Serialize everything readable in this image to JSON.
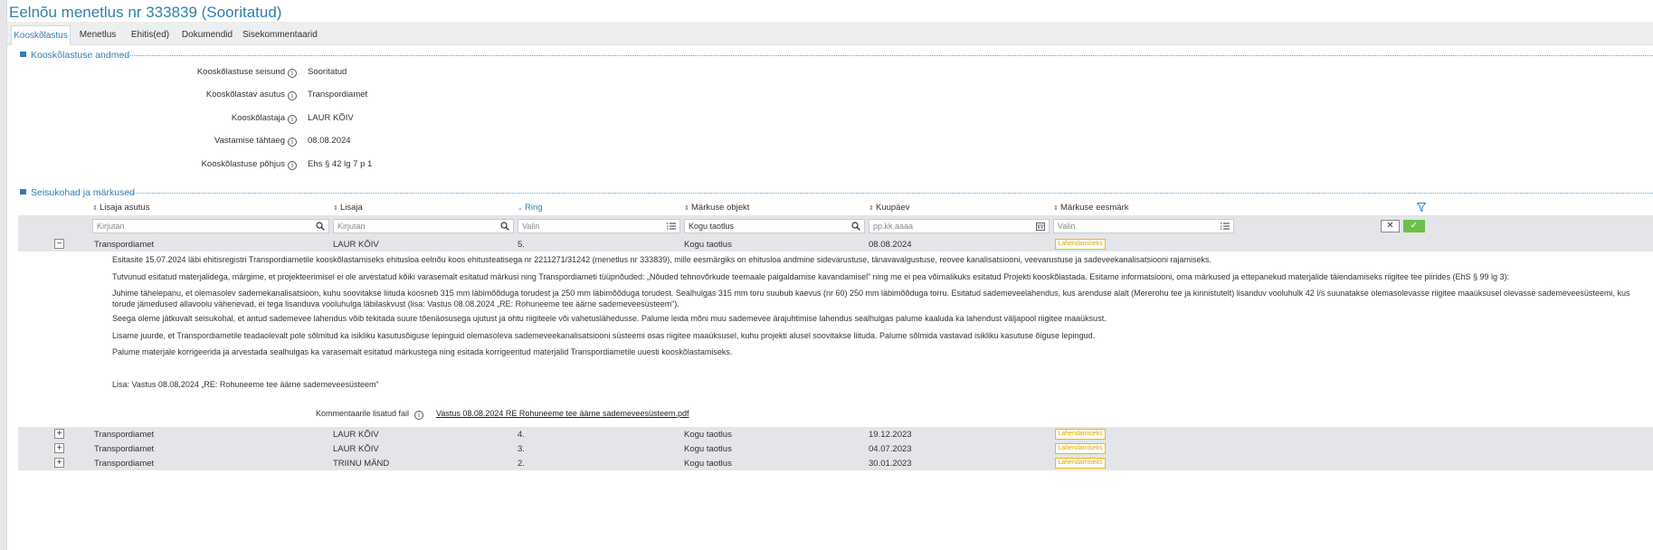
{
  "title": "Eelnõu menetlus nr 333839 (Sooritatud)",
  "tabs": [
    {
      "label": "Kooskõlastus"
    },
    {
      "label": "Menetlus"
    },
    {
      "label": "Ehitis(ed)"
    },
    {
      "label": "Dokumendid"
    },
    {
      "label": "Sisekommentaarid"
    }
  ],
  "section1": {
    "title": "Kooskõlastuse andmed",
    "fields": [
      {
        "label": "Kooskõlastuse seisund",
        "value": "Sooritatud"
      },
      {
        "label": "Kooskõlastav asutus",
        "value": "Transpordiamet"
      },
      {
        "label": "Kooskõlastaja",
        "value": "LAUR KÕIV"
      },
      {
        "label": "Vastamise tähtaeg",
        "value": "08.08.2024"
      },
      {
        "label": "Kooskõlastuse põhjus",
        "value": "Ehs § 42 lg 7 p 1"
      }
    ]
  },
  "section2": {
    "title": "Seisukohad ja märkused",
    "columns": [
      {
        "label": "Lisaja asutus"
      },
      {
        "label": "Lisaja"
      },
      {
        "label": "Ring"
      },
      {
        "label": "Märkuse objekt"
      },
      {
        "label": "Kuupäev"
      },
      {
        "label": "Märkuse eesmärk"
      }
    ],
    "filters": [
      {
        "placeholder": "Kirjutan"
      },
      {
        "placeholder": "Kirjutan"
      },
      {
        "placeholder": "Valin"
      },
      {
        "value": "Kogu taotlus"
      },
      {
        "placeholder": "pp.kk.aaaa"
      },
      {
        "placeholder": "Valin"
      }
    ],
    "rows": [
      {
        "toggle": "−",
        "asutus": "Transpordiamet",
        "lisaja": "LAUR KÕIV",
        "ring": "5.",
        "objekt": "Kogu taotlus",
        "kuupaev": "08.08.2024",
        "eesmark": "Lahendamiseks"
      },
      {
        "toggle": "+",
        "asutus": "Transpordiamet",
        "lisaja": "LAUR KÕIV",
        "ring": "4.",
        "objekt": "Kogu taotlus",
        "kuupaev": "19.12.2023",
        "eesmark": "Lahendamiseks"
      },
      {
        "toggle": "+",
        "asutus": "Transpordiamet",
        "lisaja": "LAUR KÕIV",
        "ring": "3.",
        "objekt": "Kogu taotlus",
        "kuupaev": "04.07.2023",
        "eesmark": "Lahendamiseks"
      },
      {
        "toggle": "+",
        "asutus": "Transpordiamet",
        "lisaja": "TRIINU MÄND",
        "ring": "2.",
        "objekt": "Kogu taotlus",
        "kuupaev": "30.01.2023",
        "eesmark": "Lahendamiseks"
      }
    ],
    "comment": {
      "paragraphs": [
        "Esitasite 15.07.2024 läbi ehitisregistri Transpordiametile kooskõlastamiseks ehitusloa eelnõu koos ehitusteatisega nr 2211271/31242 (menetlus nr 333839), mille eesmärgiks on ehitusloa andmine sidevarustuse, tänavavalgustuse, reovee kanalisatsiooni, veevarustuse ja sadeveekanalisatsiooni rajamiseks.",
        "Tutvunud esitatud materjalidega, märgime, et projekteerimisel ei ole arvestatud kõiki varasemalt esitatud märkusi ning Transpordiameti tüüpnõuded: „Nõuded tehnovõrkude teemaale paigaldamise kavandamisel“ ning me ei pea võimalikuks esitatud Projekti kooskõlastada. Esitame informatsiooni, oma märkused ja ettepanekud materjalide täiendamiseks riigitee tee piirides (EhS § 99 lg 3):",
        "Juhime tähelepanu, et olemasolev sademekanalisatsioon, kuhu soovitakse liituda koosneb 315 mm läbimõõduga torudest ja 250 mm läbimõõduga torudest. Sealhulgas 315 mm toru suubub kaevus (nr 60) 250 mm läbimõõduga torru. Esitatud sademeveelahendus, kus arenduse alalt (Mererohu tee ja kinnistutelt) lisanduv vooluhulk 42 l/s suunatakse olemasolevasse riigitee maaüksusel olevasse sademeveesüsteemi, kus torude jämedused allavoolu vähenevad, ei tega lisanduva vooluhulga läbilaskvust (lisa: Vastus 08.08.2024 „RE: Rohuneeme tee äärne sademeveesüsteem“).",
        "Seega oleme jätkuvalt seisukohal, et antud sademevee lahendus võib tekitada suure tõenäosusega ujutust ja ohtu riigiteele või vahetuslähedusse. Palume leida mõni muu sademevee ärajuhtimise lahendus sealhulgas palume kaaluda ka lahendust väljapool riigitee maaüksust.",
        "Lisame juurde, et Transpordiametile teadaolevalt pole sõlmitud ka isikliku kasutusõiguse lepinguid olemasoleva sademeveekanalisatsiooni süsteemi osas riigitee maaüksusel, kuhu projekti alusel soovitakse liituda. Palume sõlmida vastavad isikliku kasutuse õiguse lepingud.",
        "Palume materjale korrigeerida ja arvestada sealhulgas ka varasemalt esitatud märkustega ning esitada korrigeeritud materjalid Transpordiametile uuesti kooskõlastamiseks.",
        "Lisa: Vastus 08.08.2024 „RE: Rohuneeme tee äärne sademeveesüsteem“"
      ],
      "attachment_label": "Kommentaarile lisatud fail",
      "attachment_link": "Vastus 08.08.2024 RE Rohuneeme tee äärne sademeveesüsteem.pdf"
    },
    "clear_button": "✕",
    "apply_button": "✓"
  },
  "colors": {
    "accent": "#2f7fb0",
    "badge_border": "#f2b705",
    "ok_green": "#6cc04a"
  },
  "icons": [
    "search-icon",
    "list-icon",
    "calendar-icon",
    "info-icon",
    "sort-icon",
    "filter-icon",
    "menu-icon"
  ]
}
